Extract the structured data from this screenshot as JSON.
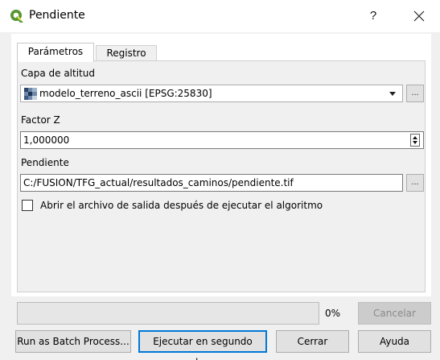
{
  "window": {
    "title": "Pendiente",
    "help_label": "?",
    "close_label": "✕"
  },
  "tabs": [
    {
      "label": "Parámetros",
      "active": true
    },
    {
      "label": "Registro",
      "active": false
    }
  ],
  "form": {
    "altitude_layer": {
      "label": "Capa de altitud",
      "value": "modelo_terreno_ascii [EPSG:25830]",
      "icon": "raster-layer-icon",
      "browse_label": "..."
    },
    "z_factor": {
      "label": "Factor Z",
      "value": "1,000000"
    },
    "slope_output": {
      "label": "Pendiente",
      "value": "C:/FUSION/TFG_actual/resultados_caminos/pendiente.tif",
      "browse_label": "..."
    },
    "open_output": {
      "label": "Abrir el archivo de salida después de ejecutar el algoritmo",
      "checked": false
    }
  },
  "progress": {
    "percent_label": "0%",
    "value": 0
  },
  "buttons": {
    "cancel": "Cancelar",
    "batch": "Run as Batch Process...",
    "run_background": "Ejecutar en segundo plano",
    "close": "Cerrar",
    "help": "Ayuda"
  },
  "colors": {
    "qgis_green": "#589632",
    "qgis_yellow": "#f0e64a",
    "focus_blue": "#0078d7"
  }
}
